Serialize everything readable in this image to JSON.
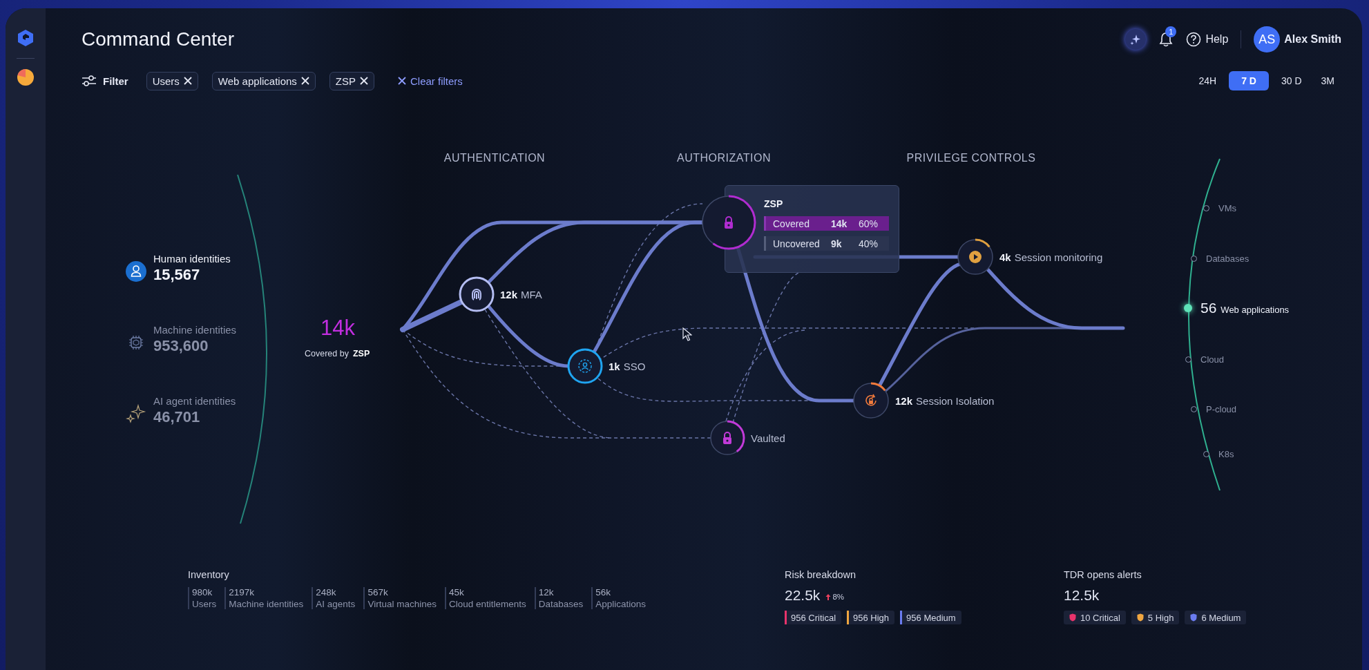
{
  "header": {
    "title": "Command Center",
    "notification_count": "1",
    "help": "Help",
    "user": {
      "initials": "AS",
      "name": "Alex Smith"
    }
  },
  "filters": {
    "label": "Filter",
    "chips": [
      "Users",
      "Web applications",
      "ZSP"
    ],
    "clear": "Clear filters"
  },
  "time_ranges": [
    {
      "label": "24H",
      "selected": false
    },
    {
      "label": "7 D",
      "selected": true
    },
    {
      "label": "30 D",
      "selected": false
    },
    {
      "label": "3M",
      "selected": false
    }
  ],
  "stages": [
    "AUTHENTICATION",
    "AUTHORIZATION",
    "PRIVILEGE CONTROLS"
  ],
  "identities": [
    {
      "kind": "human",
      "label": "Human identities",
      "value": "15,567",
      "selected": true
    },
    {
      "kind": "machine",
      "label": "Machine identities",
      "value": "953,600",
      "selected": false
    },
    {
      "kind": "ai",
      "label": "AI agent identities",
      "value": "46,701",
      "selected": false
    }
  ],
  "source": {
    "value": "14k",
    "caption": "Covered by",
    "control": "ZSP"
  },
  "nodes": [
    {
      "kind": "fingerprint",
      "count": "12k",
      "label": "MFA",
      "color": "#b4bdf2"
    },
    {
      "kind": "user",
      "count": "1k",
      "label": "SSO",
      "color": "#1fa4f0"
    },
    {
      "kind": "lock",
      "color": "#b02cd0"
    },
    {
      "kind": "lock",
      "label": "Vaulted",
      "color": "#c23ad8"
    },
    {
      "kind": "lock-rotate",
      "count": "12k",
      "label": "Session Isolation",
      "color": "#f07a3c"
    },
    {
      "kind": "play",
      "count": "4k",
      "label": "Session monitoring",
      "color": "#e0a040"
    }
  ],
  "tooltip": {
    "title": "ZSP",
    "rows": [
      {
        "label": "Covered",
        "count": "14k",
        "percent": "60%",
        "selected": true
      },
      {
        "label": "Uncovered",
        "count": "9k",
        "percent": "40%",
        "selected": false
      }
    ]
  },
  "targets": [
    {
      "label": "VMs",
      "selected": false
    },
    {
      "label": "Databases",
      "selected": false
    },
    {
      "count": "56",
      "label": "Web applications",
      "selected": true
    },
    {
      "label": "Cloud",
      "selected": false
    },
    {
      "label": "P-cloud",
      "selected": false
    },
    {
      "label": "K8s",
      "selected": false
    }
  ],
  "inventory": {
    "title": "Inventory",
    "items": [
      {
        "value": "980k",
        "label": "Users"
      },
      {
        "value": "2197k",
        "label": "Machine identities"
      },
      {
        "value": "248k",
        "label": "AI agents"
      },
      {
        "value": "567k",
        "label": "Virtual machines"
      },
      {
        "value": "45k",
        "label": "Cloud entitlements"
      },
      {
        "value": "12k",
        "label": "Databases"
      },
      {
        "value": "56k",
        "label": "Applications"
      }
    ]
  },
  "risk": {
    "title": "Risk breakdown",
    "value": "22.5k",
    "trend": "8%",
    "items": [
      {
        "label": "956 Critical",
        "color": "#e8336b"
      },
      {
        "label": "956 High",
        "color": "#f0a640"
      },
      {
        "label": "956 Medium",
        "color": "#6b7cf0"
      }
    ]
  },
  "alerts": {
    "title": "TDR opens alerts",
    "value": "12.5k",
    "items": [
      {
        "label": "10 Critical",
        "color": "#e8336b"
      },
      {
        "label": "5 High",
        "color": "#f0a640"
      },
      {
        "label": "6 Medium",
        "color": "#6b7cf0"
      }
    ]
  }
}
